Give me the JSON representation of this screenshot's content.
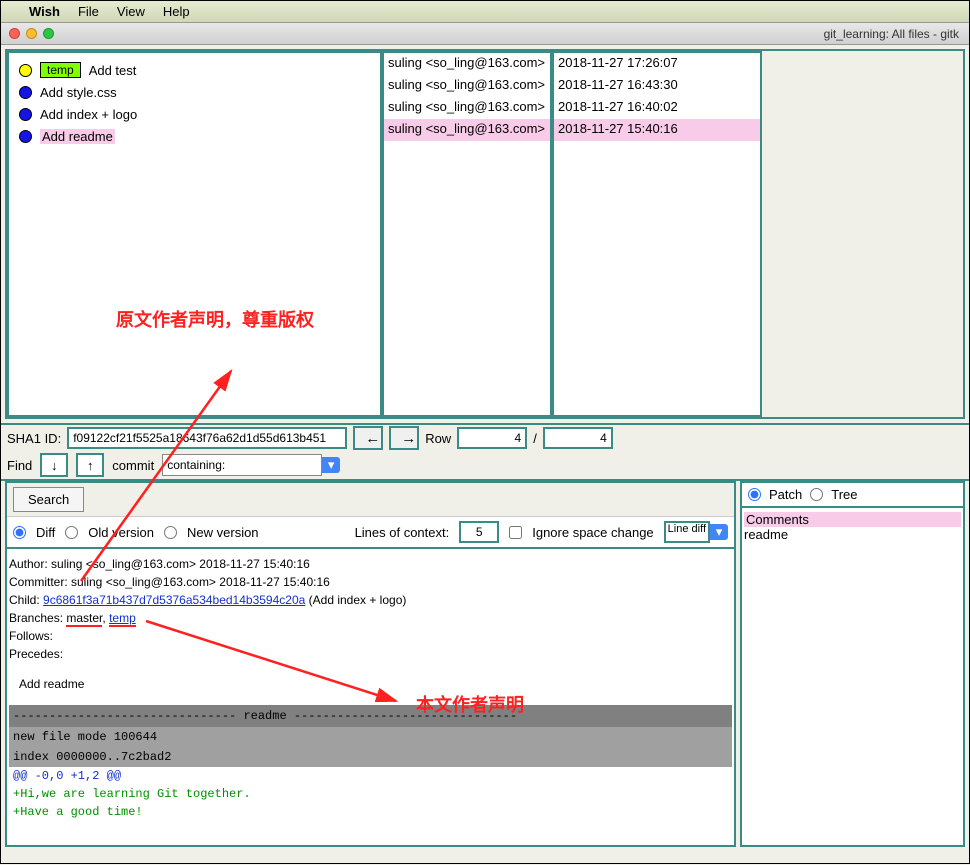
{
  "menubar": {
    "app": "Wish",
    "items": [
      "File",
      "View",
      "Help"
    ]
  },
  "window_title": "git_learning: All files - gitk",
  "commits": [
    {
      "dot": "y",
      "tag": "temp",
      "msg": "Add test",
      "author": "suling <so_ling@163.com>",
      "date": "2018-11-27 17:26:07",
      "sel": false
    },
    {
      "dot": "b",
      "msg": "Add style.css",
      "author": "suling <so_ling@163.com>",
      "date": "2018-11-27 16:43:30",
      "sel": false
    },
    {
      "dot": "b",
      "msg": "Add index + logo",
      "author": "suling <so_ling@163.com>",
      "date": "2018-11-27 16:40:02",
      "sel": false
    },
    {
      "dot": "b",
      "msg": "Add readme",
      "author": "suling <so_ling@163.com>",
      "date": "2018-11-27 15:40:16",
      "sel": true
    }
  ],
  "sha": {
    "label": "SHA1 ID:",
    "value": "f09122cf21f5525a18643f76a62d1d55d613b451"
  },
  "nav": {
    "row_label": "Row",
    "cur": "4",
    "sep": "/",
    "total": "4"
  },
  "find": {
    "label": "Find",
    "mode": "commit",
    "type": "containing:"
  },
  "search_btn": "Search",
  "diffrow": {
    "diff": "Diff",
    "old": "Old version",
    "new": "New version",
    "lines_label": "Lines of context:",
    "lines": "5",
    "ignore": "Ignore space change",
    "linediff": "Line diff"
  },
  "meta": {
    "author": "Author: suling <so_ling@163.com>  2018-11-27 15:40:16",
    "committer": "Committer: suling <so_ling@163.com>  2018-11-27 15:40:16",
    "child_label": "Child:",
    "child_hash": "9c6861f3a71b437d7d5376a534bed14b3594c20a",
    "child_msg": "(Add index + logo)",
    "branches_label": "Branches:",
    "branches": [
      "master",
      "temp"
    ],
    "follows": "Follows:",
    "precedes": "Precedes:",
    "subject": "Add readme"
  },
  "diff": {
    "header": "------------------------------- readme -------------------------------",
    "g1": "new file mode 100644",
    "g2": "index 0000000..7c2bad2",
    "hunk": "@@ -0,0 +1,2 @@",
    "l1": "+Hi,we are learning Git together.",
    "l2": "+Have a good time!"
  },
  "right": {
    "patch": "Patch",
    "tree": "Tree",
    "comments": "Comments",
    "file": "readme"
  },
  "annotations": {
    "a1": "原文作者声明，尊重版权",
    "a2": "本文作者声明"
  }
}
